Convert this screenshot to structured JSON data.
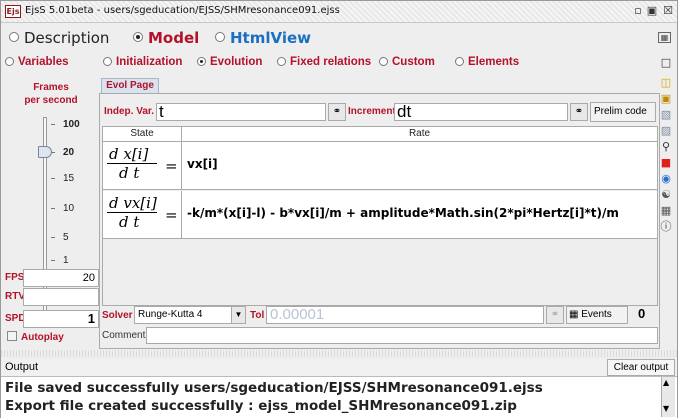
{
  "window": {
    "title": "EjsS 5.01beta - users/sgeducation/EJSS/SHMresonance091.ejss",
    "icon_text": "Ejs"
  },
  "main_tabs": [
    {
      "label": "Description",
      "selected": false
    },
    {
      "label": "Model",
      "selected": true
    },
    {
      "label": "HtmlView",
      "selected": false
    }
  ],
  "sub_tabs": [
    {
      "label": "Variables",
      "selected": false
    },
    {
      "label": "Initialization",
      "selected": false
    },
    {
      "label": "Evolution",
      "selected": true
    },
    {
      "label": "Fixed relations",
      "selected": false
    },
    {
      "label": "Custom",
      "selected": false
    },
    {
      "label": "Elements",
      "selected": false
    }
  ],
  "left_panel": {
    "frames_label_line1": "Frames",
    "frames_label_line2": "per second",
    "ticks": [
      "100",
      "20",
      "15",
      "10",
      "5",
      "1"
    ],
    "slider_value": 20,
    "fps_label": "FPS",
    "fps_value": "20",
    "rtv_label": "RTV",
    "rtv_value": "",
    "spd_label": "SPD",
    "spd_value": "1",
    "autoplay_label": "Autoplay"
  },
  "page_tab": "Evol Page",
  "evolution": {
    "indep_label": "Indep. Var.",
    "indep_value": "t",
    "increment_label": "Increment",
    "increment_value": "dt",
    "prelim_label": "Prelim code",
    "col_state": "State",
    "col_rate": "Rate",
    "rows": [
      {
        "num": "d x[i]",
        "den": "d t",
        "eq": "=",
        "rate": "vx[i]"
      },
      {
        "num": "d vx[i]",
        "den": "d t",
        "eq": "=",
        "rate": "-k/m*(x[i]-l) - b*vx[i]/m + amplitude*Math.sin(2*pi*Hertz[i]*t)/m"
      }
    ],
    "solver_label": "Solver",
    "solver_value": "Runge-Kutta 4",
    "tol_label": "Tol",
    "tol_value": "0.00001",
    "events_label": "Events",
    "events_count": "0",
    "comment_label": "Comment",
    "comment_value": ""
  },
  "output": {
    "title": "Output",
    "clear_label": "Clear output",
    "lines": [
      "File saved successfully users/sgeducation/EJSS/SHMresonance091.ejss",
      "Export file created successfully : ejss_model_SHMresonance091.zip"
    ]
  },
  "colors": {
    "label_red": "#b2122a",
    "tab_blue": "#1a6fc0"
  }
}
